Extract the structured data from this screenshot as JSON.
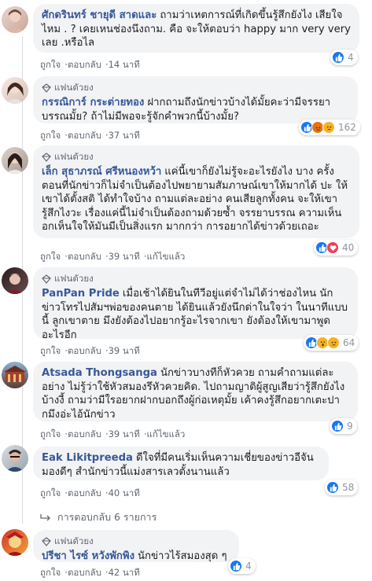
{
  "labels": {
    "like": "ถูกใจ",
    "reply": "ตอบกลับ",
    "edited": "แก้ไขแล้ว",
    "fan_badge": "แฟนตัวยง"
  },
  "comments": [
    {
      "author": "ศักดรินทร์ ชายุดี สาดและ",
      "fan": false,
      "text": "ถามว่าเหตการณ์ที่เกิดขึ้นรู้สึกยังไง เสียใจไหม . ? เคยเหนช่องนึงถาม. คือ จะให้ตอบว่า happy มาก very very เลย .หรือไล",
      "time": "14 นาที",
      "edited": false,
      "reactions": [
        "like"
      ],
      "count": "4"
    },
    {
      "author": "กรรณิการ์ กระต่ายทอง",
      "fan": true,
      "text": "ฝากถามถึงนักข่าวบ้างได้มั้ยคะว่ามีจรรยาบรรณมั้ย? ถ้าไม่มีพอจะรู้จักคำพวกนี้บ้างมั้ย?",
      "time": "37 นาที",
      "edited": false,
      "reactions": [
        "like",
        "angry",
        "sad"
      ],
      "count": "162"
    },
    {
      "author": "เล็ก สุธาภรณ์ ศรีหนองหว้า",
      "fan": true,
      "text": "แค่นี้เขาก็ยังไม่รู้จะอะไรยังไง บาง ครั้งตอนที่นักข่าวก็ไม่จำเป็นต้องไปพยายามสัมภาษณ์เขาให้มากได้ ปะ ให้เขาได้ตั้งสติ ได้ทำใจบ้าง ถามแต่ละอย่าง คนเสียลูกทั้งคน จะให้เขารู้สึกไงวะ เรื่องแค่นี้ไม่จำเป็นต้องถามด้วยซ้ำ จรรยาบรรณ ความเห็นอกเห็นใจให้มันมีเป็นสิ่งแรก มากกว่า การอยากได้ข่าวด้วยเถอะ",
      "time": "39 นาที",
      "edited": true,
      "reactions": [
        "like",
        "love"
      ],
      "count": "40"
    },
    {
      "author": "PanPan Pride",
      "fan": true,
      "text": "เมื่อเช้าได้ยินในทีวีอยู่แต่จำไม่ได้ว่าช่องไหน นักข่าวโทรไปสัมฯพ่อของคนตาย ได้ยินแล้วยังนึกด่าในใจว่า ในนาทีแบบนี้ ลูกเขาตาย มึงยังต้องไปอยากรู้อะไรจากเขา ยังต้องให้เขามาพูดอะไรอีก",
      "time": "39 นาที",
      "edited": false,
      "reactions": [
        "like",
        "wow",
        "sad"
      ],
      "count": "64"
    },
    {
      "author": "Atsada Thongsanga",
      "fan": false,
      "text": "นักข่าวบางทีก็หัวควย ถามคำถามแต่ละอย่าง ไม่รู้ว่าใช้หัวสมองรึหัวควยคิด. ไปถามญาติผู้สูญเสียว่ารู้สึกยังไงบ้างงี้ ถามว่ามีใรอยากฝากบอกถึงผู้ก่อเหตุมั้ย เค้าคงรู้สึกอยากเตะปากมึงอ่ะไอ้นักข่าว",
      "time": "39 นาที",
      "edited": true,
      "reactions": [
        "like"
      ],
      "count": "9"
    },
    {
      "author": "Eak Likitpreeda",
      "fan": false,
      "text": "ดีใจที่มีคนเริ่มเห็นความเชี่ยของข่าวอีจัน มองดีๆ สำนักข่าวนี้แม่งสารเลวตั้งนานแล้ว",
      "time": "40 นาที",
      "edited": false,
      "reactions": [
        "like"
      ],
      "count": "58"
    },
    {
      "author": "ปรีชา ไรซ์ หวังพักพิง",
      "fan": true,
      "text": "นักข่าวไร้สมองสุด ๆ",
      "time": "42 นาที",
      "edited": false,
      "reactions": [
        "like"
      ],
      "count": "4"
    }
  ],
  "more_replies": "การตอบกลับ 6 รายการ",
  "colors": {
    "link": "#385898",
    "bubble": "#f2f3f5",
    "like": "#1877f2",
    "love": "#f33e58"
  }
}
